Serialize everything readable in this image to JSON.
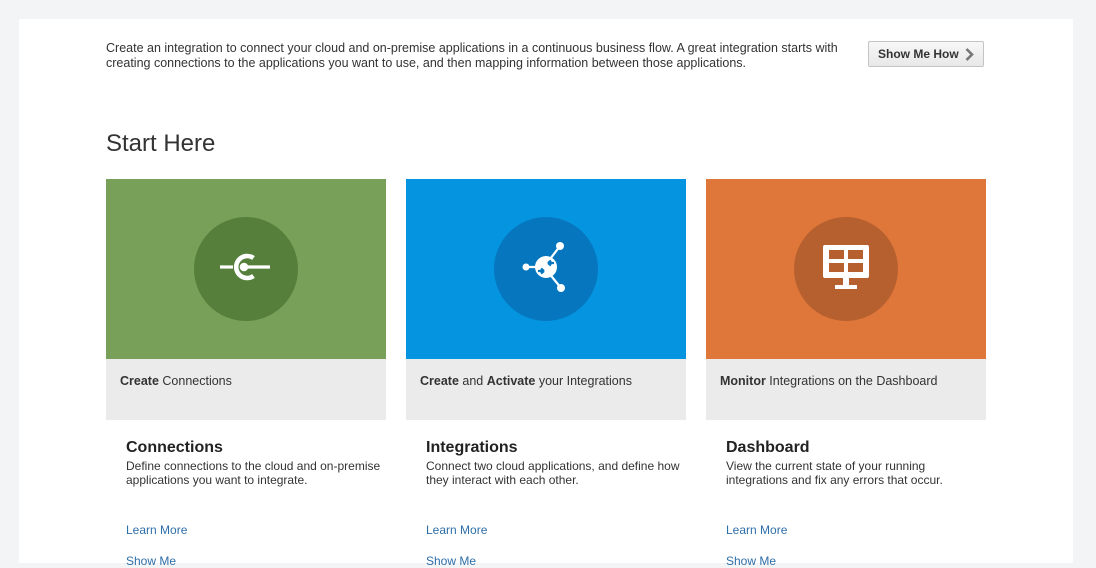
{
  "intro": {
    "text": "Create an integration to connect your cloud and on-premise applications in a continuous business flow. A great integration starts with creating connections to the applications you want to use, and then mapping information between those applications.",
    "show_me_how_label": "Show Me How"
  },
  "section_title": "Start Here",
  "cards": [
    {
      "color": "#78a058",
      "circle_color": "#567f3b",
      "icon": "connection-plug-icon",
      "caption_parts": [
        {
          "text": "Create",
          "bold": true
        },
        {
          "text": " Connections",
          "bold": false
        }
      ]
    },
    {
      "color": "#0595e0",
      "circle_color": "#0677bf",
      "icon": "integration-hub-icon",
      "caption_parts": [
        {
          "text": "Create",
          "bold": true
        },
        {
          "text": " and ",
          "bold": false
        },
        {
          "text": "Activate",
          "bold": true
        },
        {
          "text": " your Integrations",
          "bold": false
        }
      ]
    },
    {
      "color": "#de7739",
      "circle_color": "#b7602f",
      "icon": "dashboard-monitor-icon",
      "caption_parts": [
        {
          "text": "Monitor",
          "bold": true
        },
        {
          "text": " Integrations on the Dashboard",
          "bold": false
        }
      ]
    }
  ],
  "info": [
    {
      "title": "Connections",
      "description": "Define connections to the cloud and on-premise applications you want to integrate.",
      "learn_more": "Learn More",
      "show_me": "Show Me"
    },
    {
      "title": "Integrations",
      "description": "Connect two cloud applications, and define how they interact with each other.",
      "learn_more": "Learn More",
      "show_me": "Show Me"
    },
    {
      "title": "Dashboard",
      "description": "View the current state of your running integrations and fix any errors that occur.",
      "learn_more": "Learn More",
      "show_me": "Show Me"
    }
  ]
}
